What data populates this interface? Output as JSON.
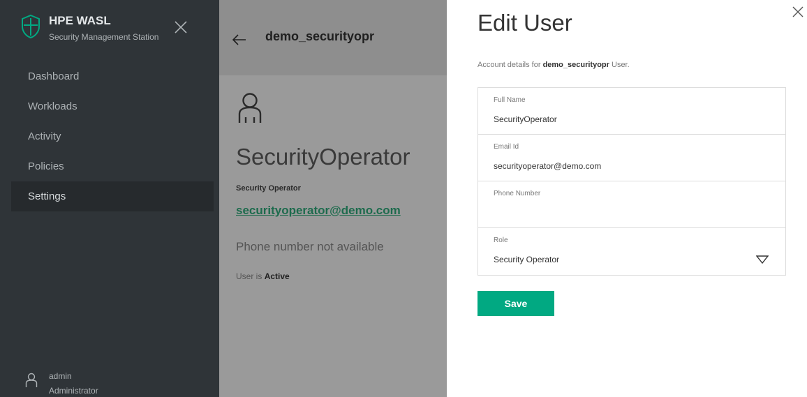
{
  "sidebar": {
    "brand_title": "HPE WASL",
    "brand_subtitle": "Security Management Station",
    "items": [
      {
        "label": "Dashboard"
      },
      {
        "label": "Workloads"
      },
      {
        "label": "Activity"
      },
      {
        "label": "Policies"
      },
      {
        "label": "Settings",
        "active": true
      }
    ],
    "user": {
      "name": "admin",
      "role": "Administrator"
    }
  },
  "detail": {
    "username": "demo_securityopr",
    "full_name": "SecurityOperator",
    "role": "Security Operator",
    "email": "securityoperator@demo.com",
    "phone": "Phone number not available",
    "status_prefix": "User is",
    "status_value": "Active"
  },
  "edit_panel": {
    "title": "Edit User",
    "desc_prefix": "Account details for",
    "desc_user": "demo_securityopr",
    "desc_suffix": "User.",
    "fields": [
      {
        "label": "Full Name",
        "value": "SecurityOperator"
      },
      {
        "label": "Email Id",
        "value": "securityoperator@demo.com"
      },
      {
        "label": "Phone Number",
        "value": ""
      },
      {
        "label": "Role",
        "value": "Security Operator"
      }
    ],
    "save_label": "Save"
  },
  "colors": {
    "sidebar_bg": "#2f3438",
    "accent_green": "#01a982",
    "link_green": "#1d6b4d"
  },
  "icons": {
    "brand": "shield-logo-icon",
    "close": "close-icon",
    "back": "arrow-left-icon",
    "user": "user-icon",
    "dropdown": "triangle-down-icon"
  }
}
